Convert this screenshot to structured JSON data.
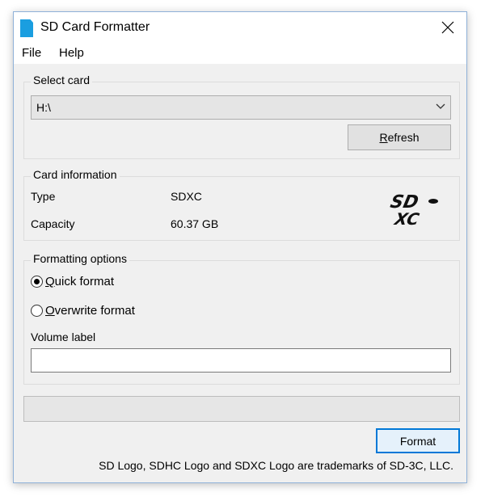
{
  "window": {
    "title": "SD Card Formatter",
    "app_icon": "sd-card-icon",
    "close_icon": "close-icon"
  },
  "menu": {
    "items": [
      {
        "label": "File"
      },
      {
        "label": "Help"
      }
    ]
  },
  "select_card": {
    "title": "Select card",
    "selected": "H:\\",
    "refresh_accel": "R",
    "refresh_rest": "efresh"
  },
  "card_info": {
    "title": "Card information",
    "type_label": "Type",
    "type_value": "SDXC",
    "capacity_label": "Capacity",
    "capacity_value": "60.37 GB",
    "logo_text_top": "SD",
    "logo_text_bottom": "XC"
  },
  "format_options": {
    "title": "Formatting options",
    "quick_accel": "Q",
    "quick_rest": "uick format",
    "quick_checked": true,
    "overwrite_accel": "O",
    "overwrite_rest": "verwrite format",
    "overwrite_checked": false,
    "volume_label": "Volume label",
    "volume_value": ""
  },
  "progress": {
    "value_percent": 0
  },
  "actions": {
    "format_label": "Format"
  },
  "footer": {
    "trademark": "SD Logo, SDHC Logo and SDXC Logo are trademarks of SD-3C, LLC."
  },
  "colors": {
    "accent": "#0078d7",
    "icon_blue": "#1a9ee0",
    "window_bg": "#f0f0f0"
  }
}
